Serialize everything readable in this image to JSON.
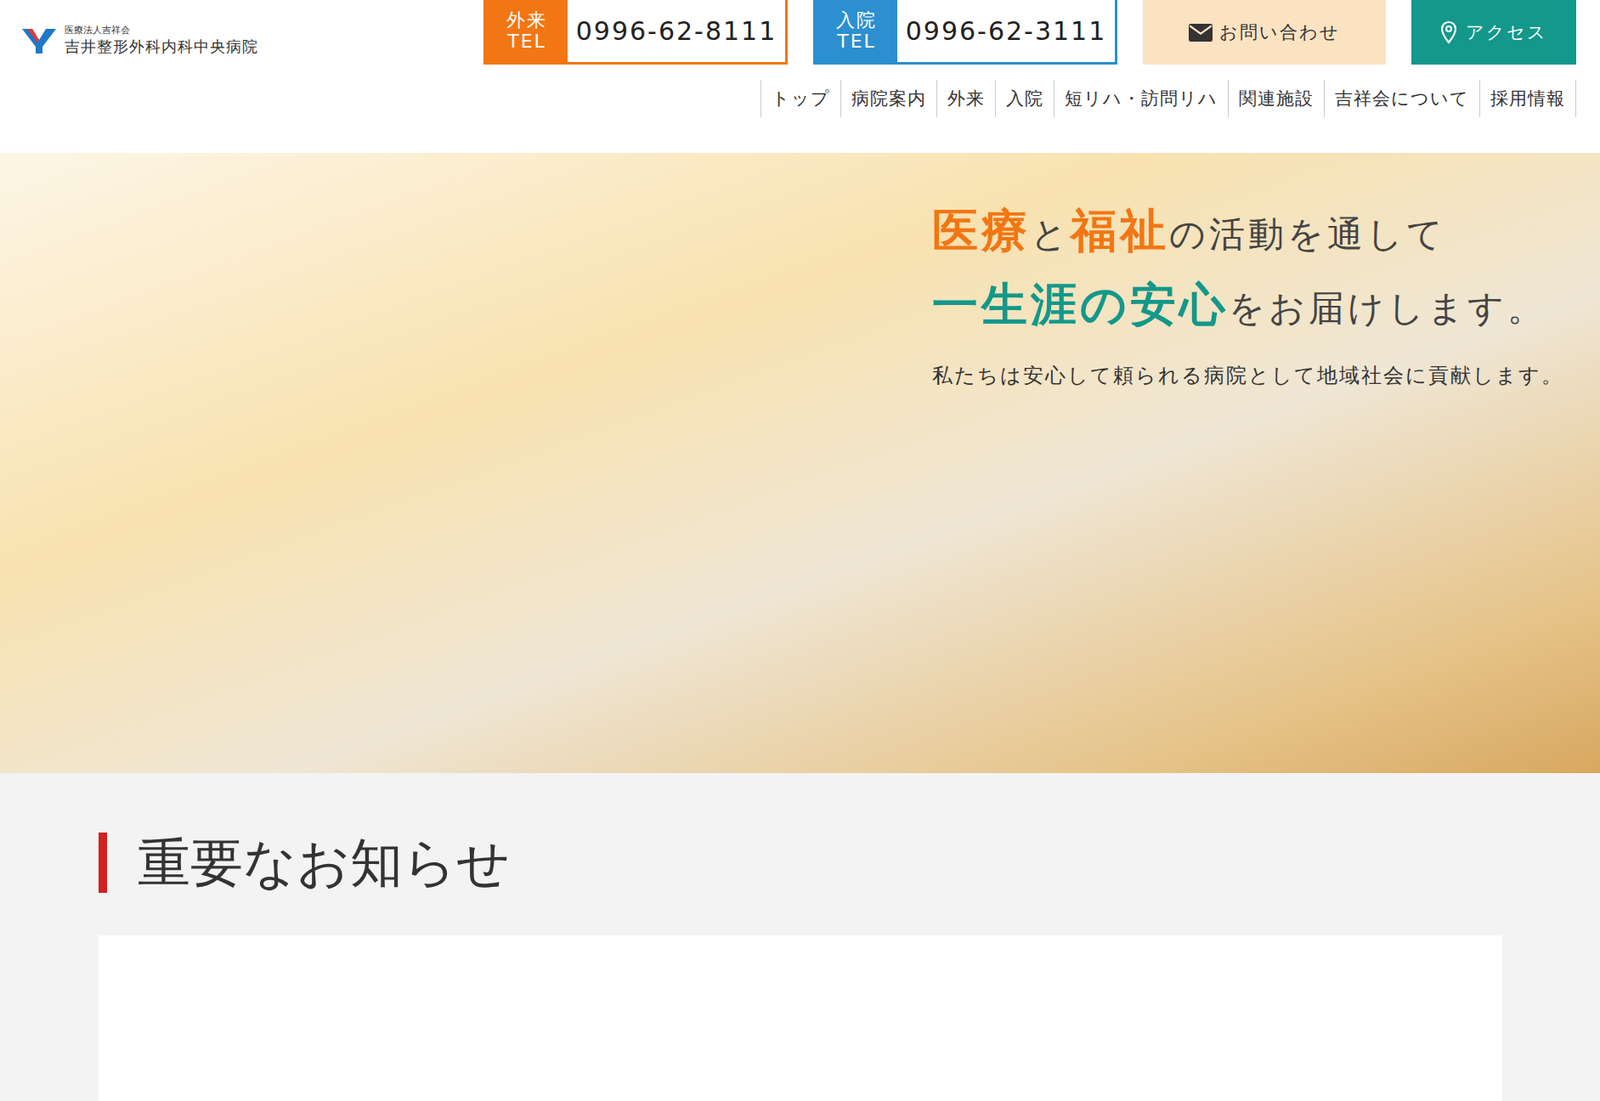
{
  "logo": {
    "org": "医療法人吉祥会",
    "name": "吉井整形外科内科中央病院"
  },
  "tel": [
    {
      "label": "外来",
      "sub": "TEL",
      "number": "0996-62-8111",
      "color": "#f27613"
    },
    {
      "label": "入院",
      "sub": "TEL",
      "number": "0996-62-3111",
      "color": "#2b8fd0"
    }
  ],
  "contact": {
    "label": "お問い合わせ"
  },
  "access": {
    "label": "アクセス"
  },
  "nav": [
    "トップ",
    "病院案内",
    "外来",
    "入院",
    "短リハ・訪問リハ",
    "関連施設",
    "吉祥会について",
    "採用情報"
  ],
  "hero": {
    "lines": [
      [
        {
          "text": "医療",
          "color": "#f27613",
          "big": true
        },
        {
          "text": "と",
          "color": "#444444",
          "big": false
        },
        {
          "text": "福祉",
          "color": "#f27613",
          "big": true
        },
        {
          "text": "の活動を通して",
          "color": "#444444",
          "big": false
        }
      ],
      [
        {
          "text": "一生涯の安心",
          "color": "#13988a",
          "big": true
        },
        {
          "text": "をお届けします。",
          "color": "#444444",
          "big": false
        }
      ]
    ],
    "sub": "私たちは安心して頼られる病院として地域社会に貢献します。"
  },
  "notice": {
    "title": "重要なお知らせ"
  }
}
